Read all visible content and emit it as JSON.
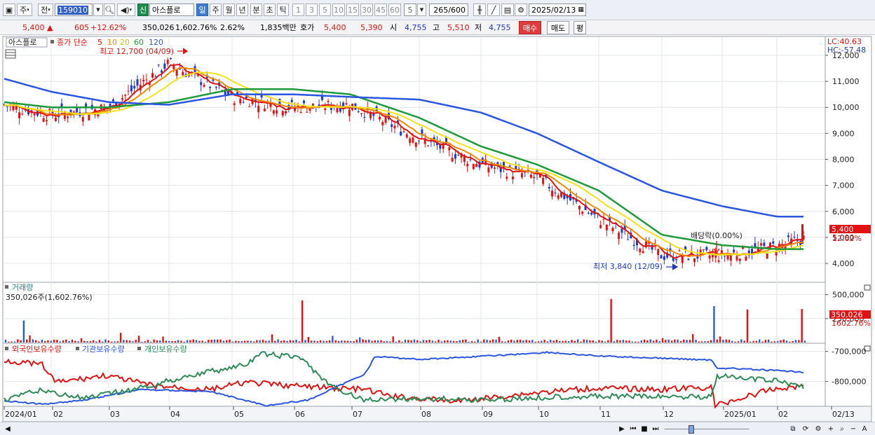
{
  "toolbar": {
    "market_btn": "주",
    "prev_btn": "전",
    "code": "159010",
    "name": "아스플로",
    "new_badge": "신",
    "periods": [
      "일",
      "주",
      "월",
      "년",
      "분",
      "초",
      "틱"
    ],
    "active_period": "일",
    "intervals": [
      "1",
      "3",
      "5",
      "10",
      "15",
      "30",
      "45",
      "60"
    ],
    "interval_value": "5",
    "count": "265",
    "count_total": "/600",
    "date": "2025/02/13"
  },
  "quote": {
    "price": "5,400",
    "arrow": "▲",
    "change": "605",
    "change_pct": "+12.62%",
    "volume": "350,026",
    "volume_ratio": "1,602.76%",
    "turnover": "2.62%",
    "amount": "1,835백만",
    "bid_label": "호가",
    "ask": "5,400",
    "bid": "5,390",
    "open_label": "시",
    "open": "4,755",
    "high_label": "고",
    "high": "5,510",
    "low_label": "저",
    "low": "4,755",
    "buy_btn": "매수",
    "sell_btn": "매도",
    "eval_btn": "평"
  },
  "price_panel": {
    "name_label": "아스플로",
    "ma_title": "종가 단순",
    "ma_periods": [
      "5",
      "10",
      "20",
      "60",
      "120"
    ],
    "ma_colors": [
      "#e01212",
      "#f08a00",
      "#f2e21a",
      "#1e9a3a",
      "#2a55e0"
    ],
    "lc": "LC:40.63",
    "hc": "HC:-57.48",
    "high_note": "최고 12,700 (04/09)",
    "low_note": "최저 3,840 (12/09)",
    "dividend_note": "배당락(0.00%)",
    "last_price": "5,400",
    "last_pct": "12.62%",
    "y_ticks": [
      "12,000",
      "11,000",
      "10,000",
      "9,000",
      "8,000",
      "7,000",
      "6,000",
      "5,000",
      "4,000"
    ]
  },
  "volume_panel": {
    "title": "거래량",
    "value": "350,026주(1,602.76%)",
    "last_value": "350,026",
    "last_pct": "1602.76%",
    "y_ticks": [
      "500,000",
      "250,000"
    ]
  },
  "holding_panel": {
    "series": [
      {
        "name": "외국인보유수량",
        "color": "#e01212"
      },
      {
        "name": "기관보유수량",
        "color": "#2a55e0"
      },
      {
        "name": "개인보유수량",
        "color": "#2e8b57"
      }
    ],
    "y_ticks": [
      "-700,000",
      "-800,000"
    ]
  },
  "x_axis": {
    "labels": [
      "2024/01",
      "02",
      "03",
      "04",
      "05",
      "06",
      "07",
      "08",
      "09",
      "10",
      "11",
      "12",
      "2025/01",
      "02",
      "02/13"
    ]
  },
  "chart_data": [
    {
      "type": "line",
      "title": "아스플로 종가 단순 5 10 20 60 120",
      "x": [
        "2024/01",
        "02",
        "03",
        "04",
        "05",
        "06",
        "07",
        "08",
        "09",
        "10",
        "11",
        "12",
        "2025/01",
        "02"
      ],
      "series": [
        {
          "name": "5",
          "values": [
            10100,
            9700,
            10000,
            11700,
            10400,
            10000,
            10100,
            8800,
            7800,
            7300,
            5700,
            4300,
            4300,
            4650
          ]
        },
        {
          "name": "60",
          "values": [
            10200,
            10000,
            10000,
            10200,
            10700,
            10700,
            10500,
            9600,
            8500,
            7800,
            6800,
            5100,
            4700,
            4550
          ]
        },
        {
          "name": "120",
          "values": [
            11100,
            10600,
            10200,
            10100,
            10500,
            10500,
            10400,
            10300,
            9800,
            9000,
            7900,
            6800,
            6200,
            5800
          ]
        }
      ],
      "ylim": [
        3300,
        12700
      ],
      "annotations": [
        "최고 12,700 (04/09)",
        "최저 3,840 (12/09)",
        "배당락(0.00%)"
      ]
    },
    {
      "type": "bar",
      "title": "거래량",
      "values_note": "daily volume",
      "last": 350026,
      "ylim": [
        0,
        600000
      ]
    },
    {
      "type": "line",
      "series": [
        {
          "name": "외국인보유수량"
        },
        {
          "name": "기관보유수량"
        },
        {
          "name": "개인보유수량"
        }
      ],
      "ylim": [
        -880000,
        -680000
      ]
    }
  ]
}
